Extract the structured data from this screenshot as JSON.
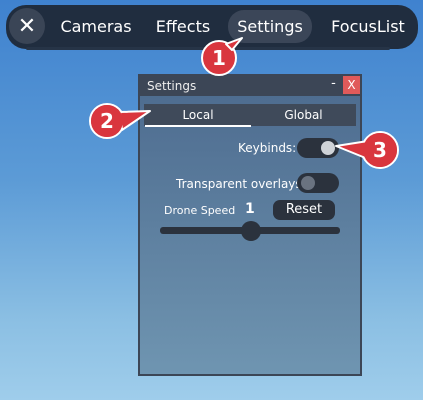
{
  "topbar": {
    "close_glyph": "✕",
    "tabs": [
      {
        "label": "Cameras"
      },
      {
        "label": "Effects"
      },
      {
        "label": "Settings"
      },
      {
        "label": "FocusList"
      }
    ],
    "active_tab": "Settings"
  },
  "settings_window": {
    "title": "Settings",
    "minimize_glyph": "-",
    "close_glyph": "X",
    "subtabs": [
      {
        "label": "Local"
      },
      {
        "label": "Global"
      }
    ],
    "active_subtab": "Local",
    "keybinds_label": "Keybinds:",
    "keybinds_on": true,
    "transparent_overlays_label": "Transparent overlays:",
    "transparent_overlays_on": false,
    "drone_speed_label": "Drone Speed",
    "drone_speed_value": "1",
    "reset_label": "Reset"
  },
  "callouts": [
    "1",
    "2",
    "3"
  ],
  "colors": {
    "callout_red": "#d9363e",
    "panel_dark": "#2b323d",
    "close_red": "#e05a5a"
  }
}
